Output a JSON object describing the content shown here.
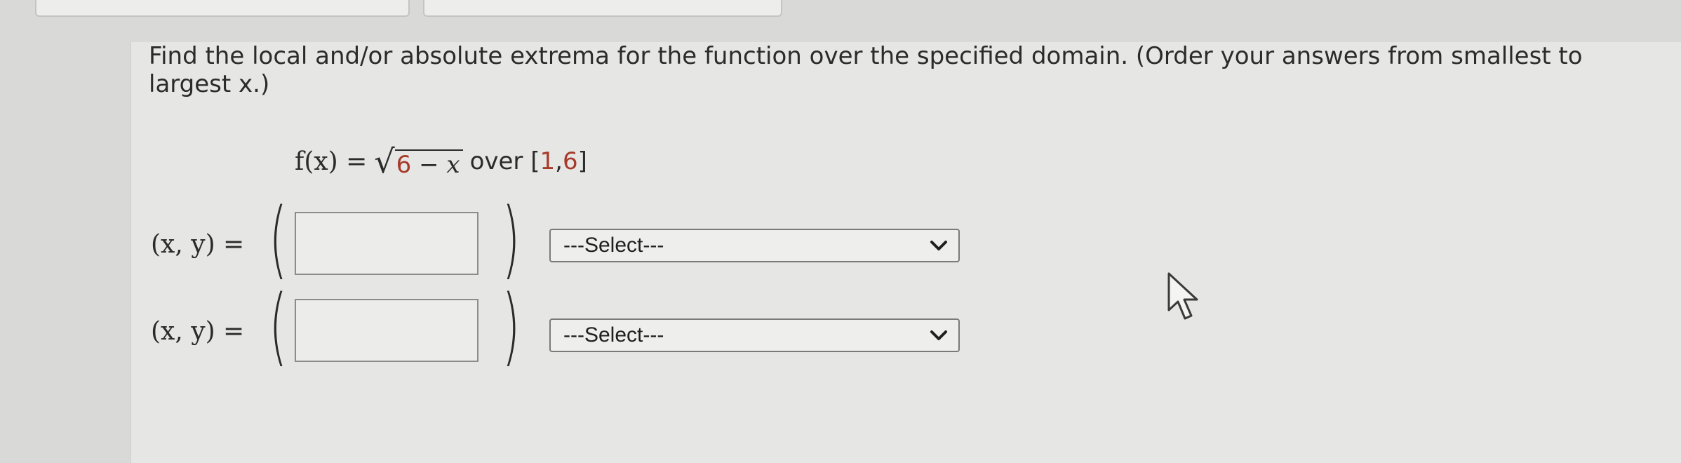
{
  "question": {
    "prompt": "Find the local and/or absolute extrema for the function over the specified domain. (Order your answers from smallest to largest x.)"
  },
  "formula": {
    "lhs": "f(x) =",
    "radicand_const": "6",
    "radicand_op": " − ",
    "radicand_var": "x",
    "word": "over",
    "bracket_open": "[",
    "interval_start": "1",
    "comma": ", ",
    "interval_end": "6",
    "bracket_close": "]"
  },
  "answers": [
    {
      "label": "(x, y) =",
      "value": "",
      "select_label": "---Select---"
    },
    {
      "label": "(x, y) =",
      "value": "",
      "select_label": "---Select---"
    }
  ],
  "icons": {
    "dropdown": "chevron-down-icon",
    "cursor": "mouse-pointer-icon"
  },
  "colors": {
    "highlight_number": "#a63a2a"
  }
}
